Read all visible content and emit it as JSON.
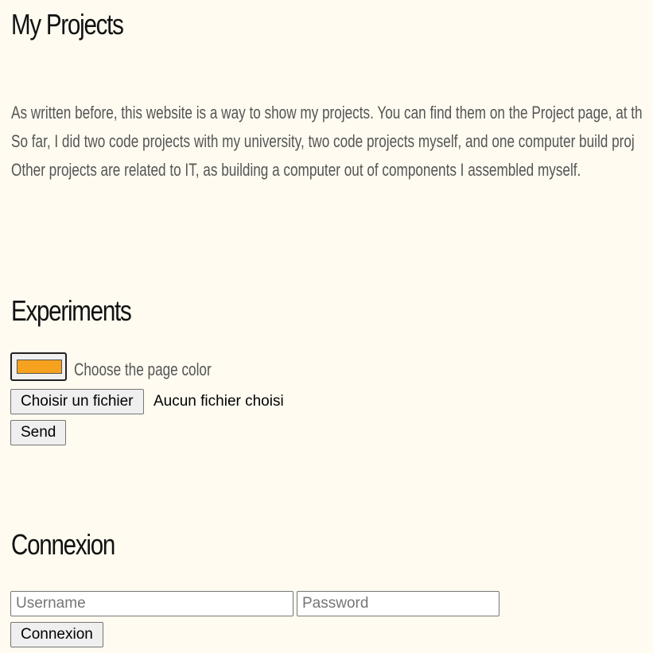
{
  "headings": {
    "my_projects": "My Projects",
    "experiments": "Experiments",
    "connexion": "Connexion"
  },
  "intro": {
    "lines": [
      "As written before, this website is a way to show my projects. You can find them on the Project page, at th",
      "So far, I did two code projects with my university, two code projects myself, and one computer build proj",
      "Other projects are related to IT, as building a computer out of components I assembled myself."
    ]
  },
  "experiments": {
    "color_value": "#f7a21e",
    "color_label": "Choose the page color",
    "file_button": "Choisir un fichier",
    "file_status": "Aucun fichier choisi",
    "send_button": "Send"
  },
  "login": {
    "username_placeholder": "Username",
    "password_placeholder": "Password",
    "submit_button": "Connexion"
  },
  "colors": {
    "background": "#fffbf0",
    "body_text": "#555555"
  }
}
